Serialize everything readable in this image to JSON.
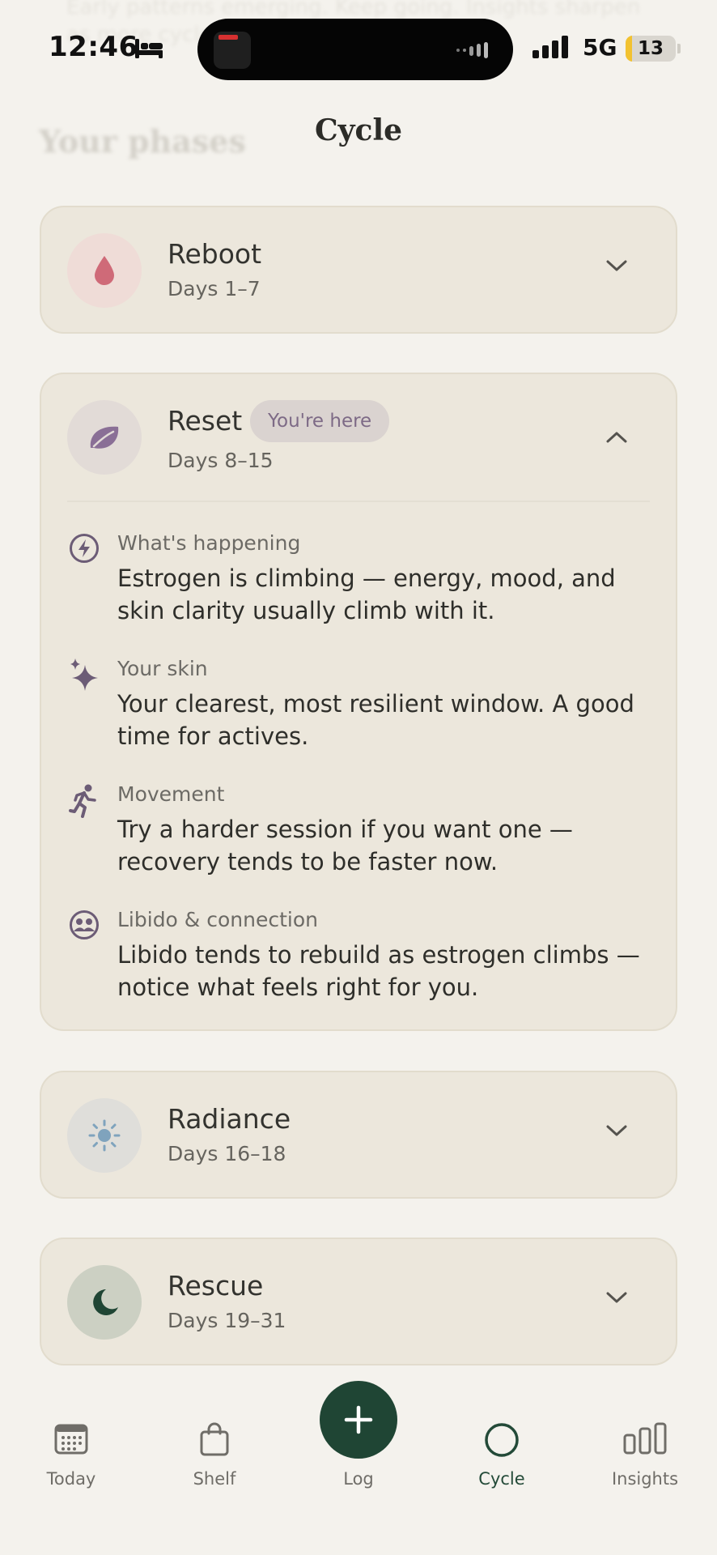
{
  "status_bar": {
    "time": "12:46",
    "network": "5G",
    "battery": "13",
    "battery_level": 0.13
  },
  "background_text": {
    "line1": "Early patterns emerging. Keep going. Insights sharpen",
    "line2": "as more cycles are logged.",
    "section_title": "Your phases"
  },
  "header": {
    "title": "Cycle"
  },
  "phases": [
    {
      "name": "Reboot",
      "days": "Days 1–7",
      "icon": "drop-icon",
      "expanded": false,
      "accent": "#cf6a78"
    },
    {
      "name": "Reset",
      "days": "Days 8–15",
      "icon": "leaf-icon",
      "expanded": true,
      "badge": "You're here",
      "accent": "#8a6f96",
      "details": [
        {
          "icon": "lightning-icon",
          "label": "What's happening",
          "text": "Estrogen is climbing — energy, mood, and skin clarity usually climb with it."
        },
        {
          "icon": "sparkles-icon",
          "label": "Your skin",
          "text": "Your clearest, most resilient window. A good time for actives."
        },
        {
          "icon": "running-icon",
          "label": "Movement",
          "text": "Try a harder session if you want one — recovery tends to be faster now."
        },
        {
          "icon": "people-icon",
          "label": "Libido & connection",
          "text": "Libido tends to rebuild as estrogen climbs — notice what feels right for you."
        }
      ]
    },
    {
      "name": "Radiance",
      "days": "Days 16–18",
      "icon": "sun-icon",
      "expanded": false,
      "accent": "#7fa3bd"
    },
    {
      "name": "Rescue",
      "days": "Days 19–31",
      "icon": "moon-icon",
      "expanded": false,
      "accent": "#1f4534"
    }
  ],
  "nav": {
    "today": "Today",
    "shelf": "Shelf",
    "log": "Log",
    "cycle": "Cycle",
    "insights": "Insights",
    "active": "cycle"
  },
  "colors": {
    "background": "#f4f2ed",
    "card": "#ece7dc",
    "primary_green": "#1f4534",
    "muted_purple": "#7d6a86"
  }
}
